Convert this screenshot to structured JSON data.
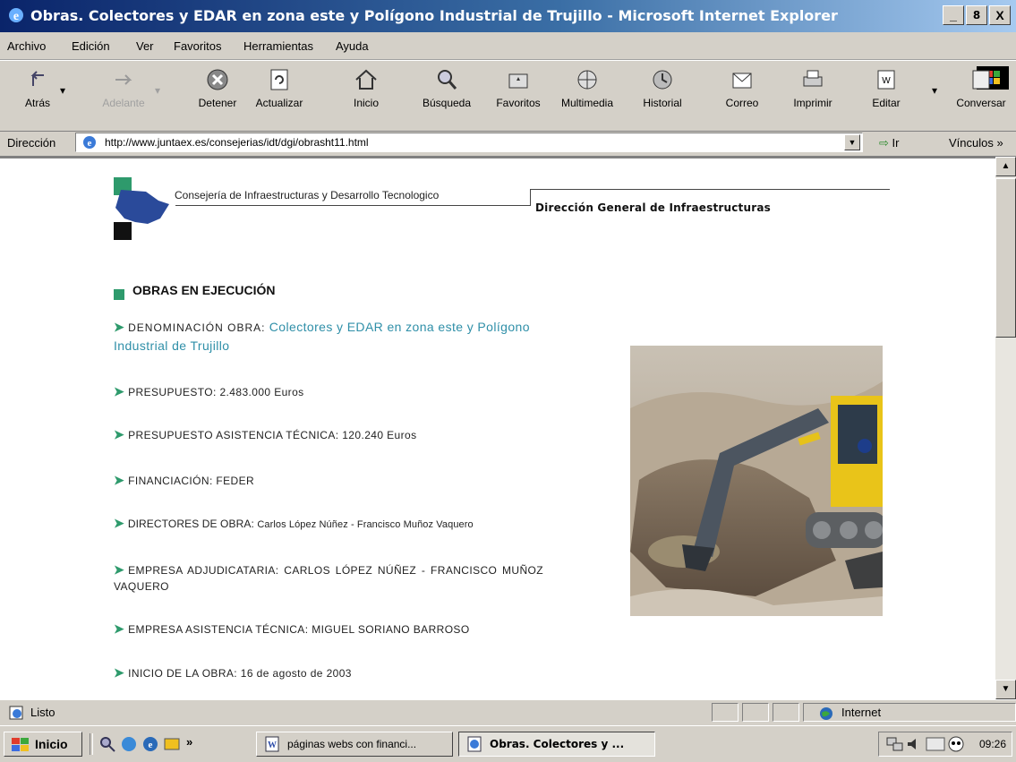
{
  "window": {
    "title": "Obras. Colectores y EDAR en zona este y Polígono Industrial de Trujillo - Microsoft Internet Explorer",
    "buttons": [
      "_",
      "8",
      "X"
    ]
  },
  "menu": [
    "Archivo",
    "Edición",
    "Ver",
    "Favoritos",
    "Herramientas",
    "Ayuda"
  ],
  "toolbar": [
    {
      "label": "Atrás",
      "icon": "back-arrow-icon"
    },
    {
      "label": "Adelante",
      "icon": "forward-arrow-icon"
    },
    {
      "label": "Detener",
      "icon": "stop-icon"
    },
    {
      "label": "Actualizar",
      "icon": "refresh-icon"
    },
    {
      "label": "Inicio",
      "icon": "home-icon"
    },
    {
      "label": "Búsqueda",
      "icon": "search-icon"
    },
    {
      "label": "Favoritos",
      "icon": "favorites-icon"
    },
    {
      "label": "Multimedia",
      "icon": "media-icon"
    },
    {
      "label": "Historial",
      "icon": "history-icon"
    },
    {
      "label": "Correo",
      "icon": "mail-icon"
    },
    {
      "label": "Imprimir",
      "icon": "print-icon"
    },
    {
      "label": "Editar",
      "icon": "edit-icon"
    },
    {
      "label": "Conversar",
      "icon": "discuss-icon"
    }
  ],
  "address": {
    "label": "Dirección",
    "url": "http://www.juntaex.es/consejerias/idt/dgi/obrasht11.html",
    "go": "Ir",
    "links": "Vínculos »"
  },
  "page": {
    "consejeria": "Consejería de Infraestructuras y Desarrollo Tecnologico",
    "direccion": "Dirección General de Infraestructuras",
    "section_title": "OBRAS EN EJECUCIÓN",
    "items": [
      {
        "label": "DENOMINACIÓN OBRA:",
        "value": "Colectores y EDAR en zona este y Polígono",
        "value2": "Industrial de Trujillo"
      },
      {
        "label": "PRESUPUESTO:",
        "value": "2.483.000 Euros"
      },
      {
        "label": "PRESUPUESTO ASISTENCIA TÉCNICA:",
        "value": "120.240 Euros"
      },
      {
        "label": "FINANCIACIÓN:",
        "value": "FEDER"
      },
      {
        "label": "DIRECTORES DE OBRA:",
        "value": "Carlos López Núñez - Francisco Muñoz Vaquero"
      },
      {
        "label": "EMPRESA ADJUDICATARIA:",
        "value": "CARLOS LÓPEZ NÚÑEZ - FRANCISCO MUÑOZ",
        "value2": "VAQUERO"
      },
      {
        "label": "EMPRESA ASISTENCIA TÉCNICA:",
        "value": "MIGUEL SORIANO BARROSO"
      },
      {
        "label": "INICIO DE LA OBRA:",
        "value": "16 de agosto de 2003"
      }
    ]
  },
  "status": {
    "text": "Listo",
    "zone": "Internet"
  },
  "taskbar": {
    "start": "Inicio",
    "chevron": "»",
    "tasks": [
      "páginas webs con financi...",
      "Obras. Colectores y ..."
    ],
    "clock": "09:26"
  },
  "colors": {
    "accent_green": "#2e9a6c",
    "link_teal": "#2f8fa8",
    "titlebar": "#0a246a"
  }
}
